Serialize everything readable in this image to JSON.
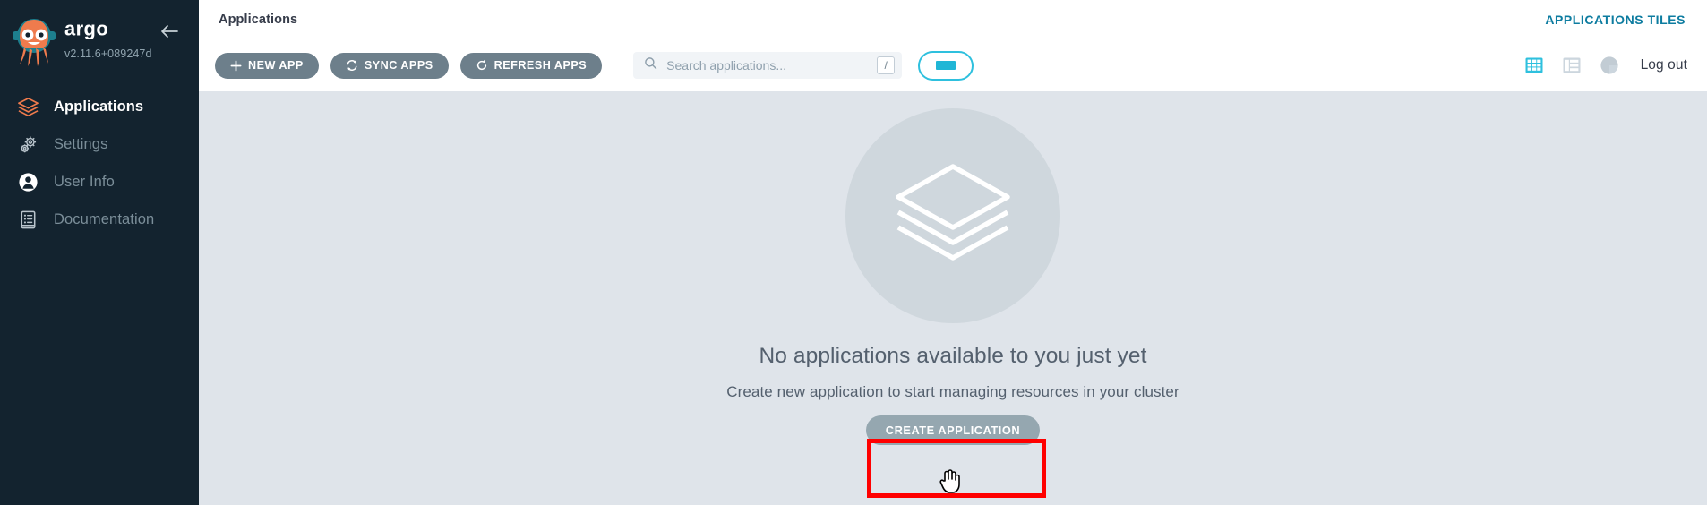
{
  "sidebar": {
    "brand_name": "argo",
    "version": "v2.11.6+089247d",
    "logo_icon": "argo-octopus-logo",
    "collapse_icon": "arrow-left-icon",
    "items": [
      {
        "label": "Applications",
        "icon": "layers-icon",
        "active": true
      },
      {
        "label": "Settings",
        "icon": "gears-icon",
        "active": false
      },
      {
        "label": "User Info",
        "icon": "user-circle-icon",
        "active": false
      },
      {
        "label": "Documentation",
        "icon": "book-icon",
        "active": false
      }
    ]
  },
  "topbar": {
    "breadcrumb": "Applications",
    "page_kicker": "APPLICATIONS TILES"
  },
  "toolbar": {
    "new_app_label": "NEW APP",
    "new_app_icon": "plus-icon",
    "sync_apps_label": "SYNC APPS",
    "sync_apps_icon": "sync-icon",
    "refresh_apps_label": "REFRESH APPS",
    "refresh_apps_icon": "refresh-icon",
    "search_placeholder": "Search applications...",
    "search_value": "",
    "search_icon": "search-icon",
    "search_shortcut_key": "/",
    "filter_pill_icon": "filter-pill-indicator",
    "view_tiles_icon": "grid-tiles-icon",
    "view_list_icon": "list-view-icon",
    "view_summary_icon": "pie-chart-icon",
    "logout_label": "Log out"
  },
  "empty_state": {
    "illustration_icon": "stacked-layers-illustration",
    "title": "No applications available to you just yet",
    "subtitle": "Create new application to start managing resources in your cluster",
    "create_button_label": "CREATE APPLICATION"
  },
  "annotation": {
    "highlight_color": "#ff0000",
    "target": "create-application-button"
  },
  "colors": {
    "sidebar_bg": "#13232f",
    "content_bg": "#dfe4ea",
    "accent_teal": "#20b6d6",
    "accent_orange": "#ef7b4d",
    "button_slate": "#6d7f8b",
    "link_blue": "#0d7ca0"
  }
}
